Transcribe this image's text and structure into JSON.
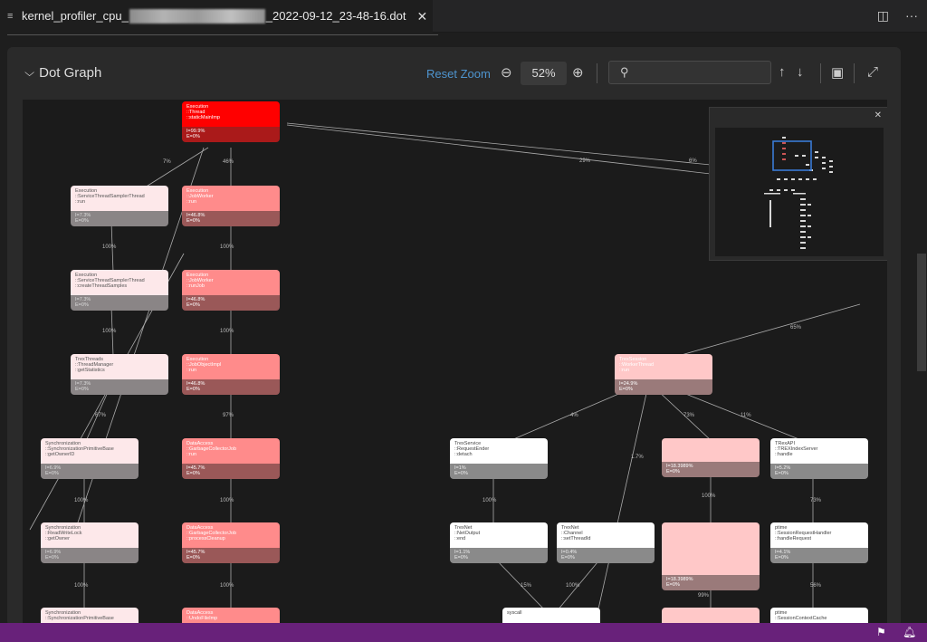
{
  "tab": {
    "title_prefix": "kernel_profiler_cpu_",
    "title_suffix": "_2022-09-12_23-48-16.dot",
    "file_icon": "lines-icon",
    "close": "✕"
  },
  "tab_actions": {
    "split": "◫",
    "more": "···"
  },
  "header": {
    "toggle_label": "Dot Graph",
    "reset_zoom": "Reset Zoom",
    "zoom_value": "52%",
    "search_placeholder": ""
  },
  "nodes": [
    {
      "id": "n1",
      "style": "red",
      "lines": [
        "Execution",
        "::Thread",
        "::staticMainImp"
      ],
      "i": "I=99.9%",
      "e": "E=0%"
    },
    {
      "id": "n2",
      "style": "light",
      "lines": [
        "Execution",
        "::ServiceThreadSamplerThread",
        "::run"
      ],
      "i": "I=7.3%",
      "e": "E=0%"
    },
    {
      "id": "n3",
      "style": "pink",
      "lines": [
        "Execution",
        "::JobWorker",
        "::run"
      ],
      "i": "I=46.8%",
      "e": "E=0%"
    },
    {
      "id": "n4",
      "style": "light",
      "lines": [
        "Execution",
        "::ServiceThreadSamplerThread",
        "::createThreadSamples"
      ],
      "i": "I=7.3%",
      "e": "E=0%"
    },
    {
      "id": "n5",
      "style": "pink",
      "lines": [
        "Execution",
        "::JobWorker",
        "::runJob"
      ],
      "i": "I=46.8%",
      "e": "E=0%"
    },
    {
      "id": "n6",
      "style": "light",
      "lines": [
        "TrexThreads",
        "::ThreadManager",
        "::getStatistics"
      ],
      "i": "I=7.3%",
      "e": "E=0%"
    },
    {
      "id": "n7",
      "style": "pink",
      "lines": [
        "Execution",
        "::JobObjectImpl",
        "::run"
      ],
      "i": "I=46.8%",
      "e": "E=0%"
    },
    {
      "id": "n8",
      "style": "pale",
      "lines": [
        "TrexSession",
        "::WorkerThread",
        "::run"
      ],
      "i": "I=24.9%",
      "e": "E=0%"
    },
    {
      "id": "n9",
      "style": "light",
      "lines": [
        "Synchronization",
        "::SynchronizationPrimitiveBase",
        "::getOwnerID"
      ],
      "i": "I=6.9%",
      "e": "E=0%"
    },
    {
      "id": "n10",
      "style": "pink",
      "lines": [
        "DataAccess",
        "::GarbageCollectorJob",
        "::run"
      ],
      "i": "I=45.7%",
      "e": "E=0%"
    },
    {
      "id": "n11",
      "style": "white",
      "lines": [
        "TrexService",
        "::RequestEnder",
        "::detach"
      ],
      "i": "I=1%",
      "e": "E=0%"
    },
    {
      "id": "n12",
      "style": "pale",
      "lines": [
        "",
        "",
        ""
      ],
      "i": "I=18.3989%",
      "e": "E=0%"
    },
    {
      "id": "n13",
      "style": "white",
      "lines": [
        "TRexAPI",
        "::TREXIndexServer",
        "::handle"
      ],
      "i": "I=5.2%",
      "e": "E=0%"
    },
    {
      "id": "n14",
      "style": "light",
      "lines": [
        "Synchronization",
        "::ReadWriteLock",
        "::getOwner"
      ],
      "i": "I=6.9%",
      "e": "E=0%"
    },
    {
      "id": "n15",
      "style": "pink",
      "lines": [
        "DataAccess",
        "::GarbageCollectorJob",
        "::processCleanup"
      ],
      "i": "I=45.7%",
      "e": "E=0%"
    },
    {
      "id": "n16",
      "style": "white",
      "lines": [
        "TrexNet",
        "::NetOutput",
        "::end"
      ],
      "i": "I=1.1%",
      "e": "E=0%"
    },
    {
      "id": "n17",
      "style": "white",
      "lines": [
        "TrexNet",
        "::Channel",
        "::setThreadId"
      ],
      "i": "I=0.4%",
      "e": "E=0%"
    },
    {
      "id": "n18",
      "style": "pale",
      "lines": [
        "",
        "",
        "",
        "",
        ""
      ],
      "i": "I=18.3989%",
      "e": "E=0%"
    },
    {
      "id": "n19",
      "style": "white",
      "lines": [
        "ptime",
        "::SessionRequestHandler",
        "::handleRequest"
      ],
      "i": "I=4.1%",
      "e": "E=0%"
    },
    {
      "id": "n20",
      "style": "light",
      "lines": [
        "Synchronization",
        "::SynchronizationPrimitiveBase"
      ],
      "i": "",
      "e": ""
    },
    {
      "id": "n21",
      "style": "pink",
      "lines": [
        "DataAccess",
        "::UndoFileImp"
      ],
      "i": "",
      "e": ""
    },
    {
      "id": "n22",
      "style": "white",
      "lines": [
        "syscall"
      ],
      "i": "",
      "e": ""
    },
    {
      "id": "n23",
      "style": "pale",
      "lines": [
        "",
        ""
      ],
      "i": "",
      "e": ""
    },
    {
      "id": "n24",
      "style": "white",
      "lines": [
        "ptime",
        "::SessionContextCache"
      ],
      "i": "",
      "e": ""
    }
  ],
  "edge_labels": {
    "e1": "7%",
    "e2": "46%",
    "e3": "29%",
    "e4": "6%",
    "e5": "100%",
    "e6": "100%",
    "e7": "100%",
    "e8": "100%",
    "e9": "67%",
    "e10": "97%",
    "e11": "65%",
    "e12": "4%",
    "e13": "73%",
    "e14": "11%",
    "e15": "1.7%",
    "e16": "100%",
    "e17": "100%",
    "e18": "100%",
    "e19": "100%",
    "e20": "73%",
    "e21": "100%",
    "e22": "100%",
    "e23": "15%",
    "e24": "100%",
    "e25": "99%",
    "e26": "56%"
  },
  "minimap": {
    "close": "✕"
  },
  "statusbar": {
    "icons": [
      "remote-icon",
      "bell-icon"
    ]
  }
}
